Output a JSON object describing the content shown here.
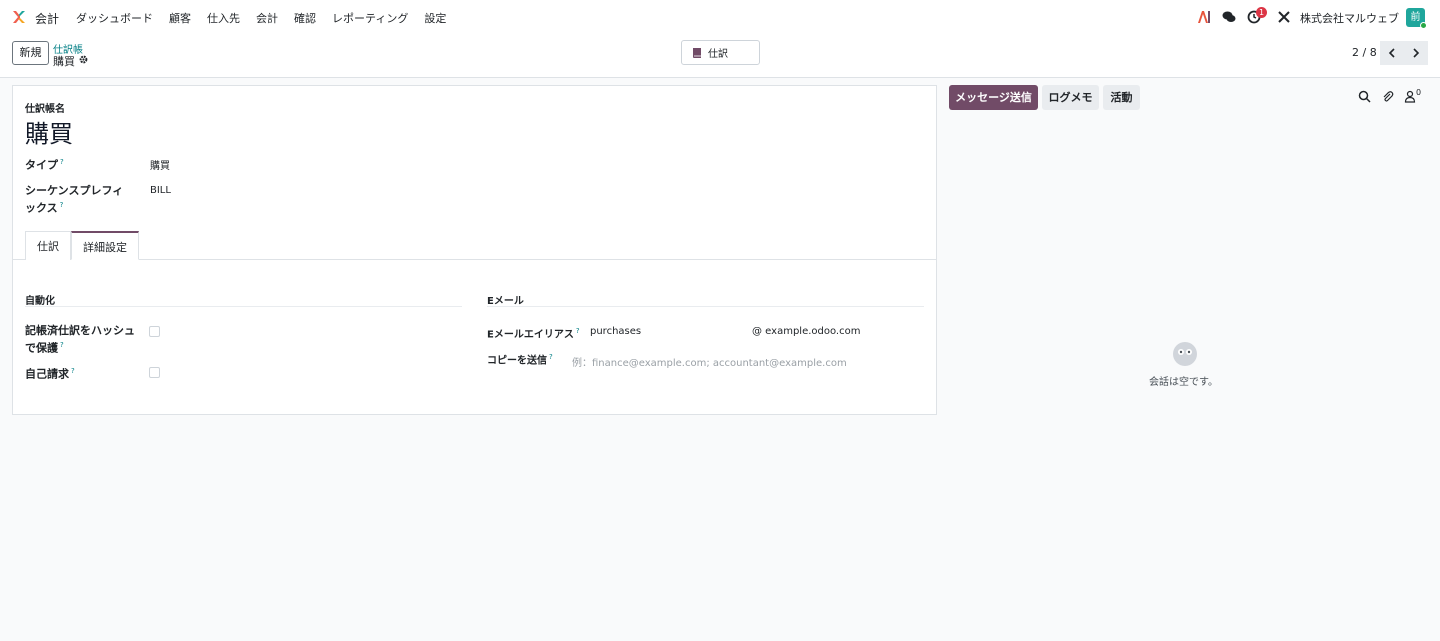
{
  "navbar": {
    "app_name": "会計",
    "menu": [
      "ダッシュボード",
      "顧客",
      "仕入先",
      "会計",
      "確認",
      "レポーティング",
      "設定"
    ],
    "activity_badge": "1",
    "company": "株式会社マルウェブ",
    "avatar_initial": "前"
  },
  "control_panel": {
    "new_button": "新規",
    "breadcrumb_parent": "仕訳帳",
    "breadcrumb_current": "購買",
    "smart_button": "仕訳",
    "pager": "2 / 8"
  },
  "form": {
    "name_label": "仕訳帳名",
    "title": "購買",
    "fields": {
      "type_label": "タイプ",
      "type_value": "購買",
      "prefix_label": "シーケンスプレフィックス",
      "prefix_value": "BILL"
    },
    "tabs": [
      "仕訳",
      "詳細設定"
    ],
    "automation": {
      "title": "自動化",
      "hash_label": "記帳済仕訳をハッシュで保護",
      "self_billing_label": "自己請求"
    },
    "email": {
      "title": "Eメール",
      "alias_label": "Eメールエイリアス",
      "alias_value": "purchases",
      "domain": "@ example.odoo.com",
      "cc_label": "コピーを送信",
      "cc_placeholder": "例：finance@example.com; accountant@example.com"
    },
    "help_mark": "?"
  },
  "chatter": {
    "send_message": "メッセージ送信",
    "log_note": "ログメモ",
    "activity": "活動",
    "followers_count": "0",
    "empty_text": "会話は空です。"
  },
  "colors": {
    "primary": "#714b67",
    "link": "#017e84",
    "badge": "#dc3545",
    "avatar": "#1fa69c"
  }
}
